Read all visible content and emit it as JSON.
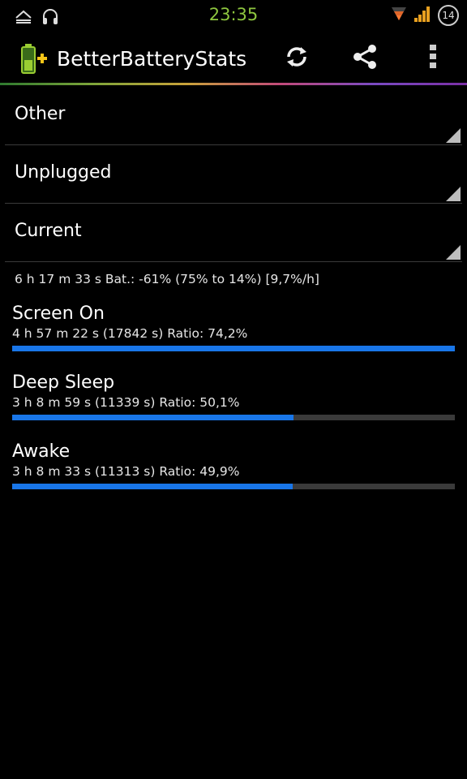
{
  "status_bar": {
    "time": "23:35",
    "notification_count": "14",
    "icons": [
      "notification-icon",
      "headphones-icon",
      "wifi-icon",
      "signal-icon"
    ]
  },
  "action_bar": {
    "title": "BetterBatteryStats",
    "icons": [
      "battery-plus-icon",
      "refresh-icon",
      "share-icon",
      "overflow-menu-icon"
    ]
  },
  "spinners": [
    {
      "label": "Other"
    },
    {
      "label": "Unplugged"
    },
    {
      "label": "Current"
    }
  ],
  "summary": "6 h 17 m 33 s  Bat.: -61% (75% to 14%) [9,7%/h]",
  "stats": [
    {
      "name": "Screen On",
      "detail": "4 h 57 m 22 s  (17842 s) Ratio: 74,2%",
      "fill": 1.0
    },
    {
      "name": "Deep Sleep",
      "detail": "3 h 8 m 59 s  (11339 s) Ratio: 50,1%",
      "fill": 0.635
    },
    {
      "name": "Awake",
      "detail": "3 h 8 m 33 s  (11313 s) Ratio: 49,9%",
      "fill": 0.634
    }
  ],
  "colors": {
    "accent_bar": "#1976e8",
    "bar_track": "#3a3a3a",
    "clock": "#8ec63f",
    "background": "#000000"
  }
}
